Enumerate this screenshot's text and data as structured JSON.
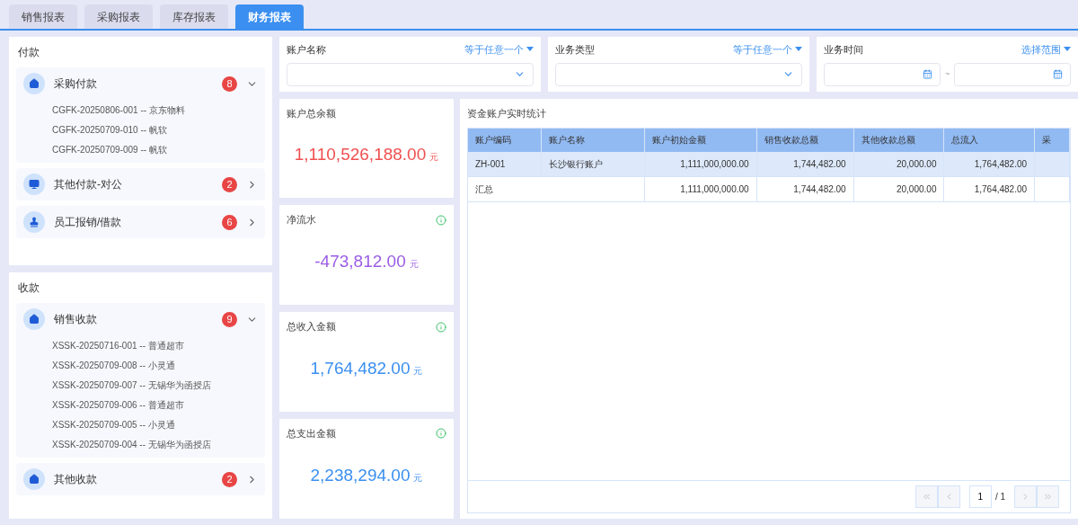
{
  "tabs": [
    {
      "label": "销售报表",
      "selected": false
    },
    {
      "label": "采购报表",
      "selected": false
    },
    {
      "label": "库存报表",
      "selected": false
    },
    {
      "label": "财务报表",
      "selected": true
    }
  ],
  "sidebar": {
    "groups": [
      {
        "title": "付款",
        "items": [
          {
            "label": "采购付款",
            "count": "8",
            "expanded": true,
            "children": [
              "CGFK-20250806-001 -- 京东物料",
              "CGFK-20250709-010 -- 帆软",
              "CGFK-20250709-009 -- 帆软"
            ]
          },
          {
            "label": "其他付款-对公",
            "count": "2",
            "expanded": false
          },
          {
            "label": "员工报销/借款",
            "count": "6",
            "expanded": false
          }
        ]
      },
      {
        "title": "收款",
        "items": [
          {
            "label": "销售收款",
            "count": "9",
            "expanded": true,
            "children": [
              "XSSK-20250716-001 -- 普通超市",
              "XSSK-20250709-008 -- 小灵通",
              "XSSK-20250709-007 -- 无锡华为函授店",
              "XSSK-20250709-006 -- 普通超市",
              "XSSK-20250709-005 -- 小灵通",
              "XSSK-20250709-004 -- 无锡华为函授店"
            ]
          },
          {
            "label": "其他收款",
            "count": "2",
            "expanded": false
          }
        ]
      }
    ]
  },
  "filters": [
    {
      "kind": "select",
      "label": "账户名称",
      "mode": "等于任意一个"
    },
    {
      "kind": "select",
      "label": "业务类型",
      "mode": "等于任意一个"
    },
    {
      "kind": "daterange",
      "label": "业务时间",
      "mode": "选择范围",
      "separator": "~"
    }
  ],
  "stats": [
    {
      "title": "账户总余额",
      "value": "1,110,526,188.00",
      "unit": "元",
      "color": "#f05050",
      "info": false
    },
    {
      "title": "净流水",
      "value": "-473,812.00",
      "unit": "元",
      "color": "#9b5de5",
      "info": true
    },
    {
      "title": "总收入金额",
      "value": "1,764,482.00",
      "unit": "元",
      "color": "#3b8ff0",
      "info": true
    },
    {
      "title": "总支出金额",
      "value": "2,238,294.00",
      "unit": "元",
      "color": "#3b8ff0",
      "info": true
    }
  ],
  "table": {
    "title": "资金账户实时统计",
    "columns": [
      "账户编码",
      "账户名称",
      "账户初始金额",
      "销售收款总额",
      "其他收款总额",
      "总流入",
      "采"
    ],
    "rows": [
      {
        "kind": "data",
        "selected": true,
        "cells": [
          "ZH-001",
          "长沙银行账户",
          "1,111,000,000.00",
          "1,744,482.00",
          "20,000.00",
          "1,764,482.00"
        ]
      },
      {
        "kind": "summary",
        "selected": false,
        "cells": [
          {
            "text": "汇总",
            "colspan": 2
          },
          "1,111,000,000.00",
          "1,744,482.00",
          "20,000.00",
          "1,764,482.00"
        ]
      }
    ],
    "pagination": {
      "page": "1",
      "total": "/ 1"
    }
  }
}
